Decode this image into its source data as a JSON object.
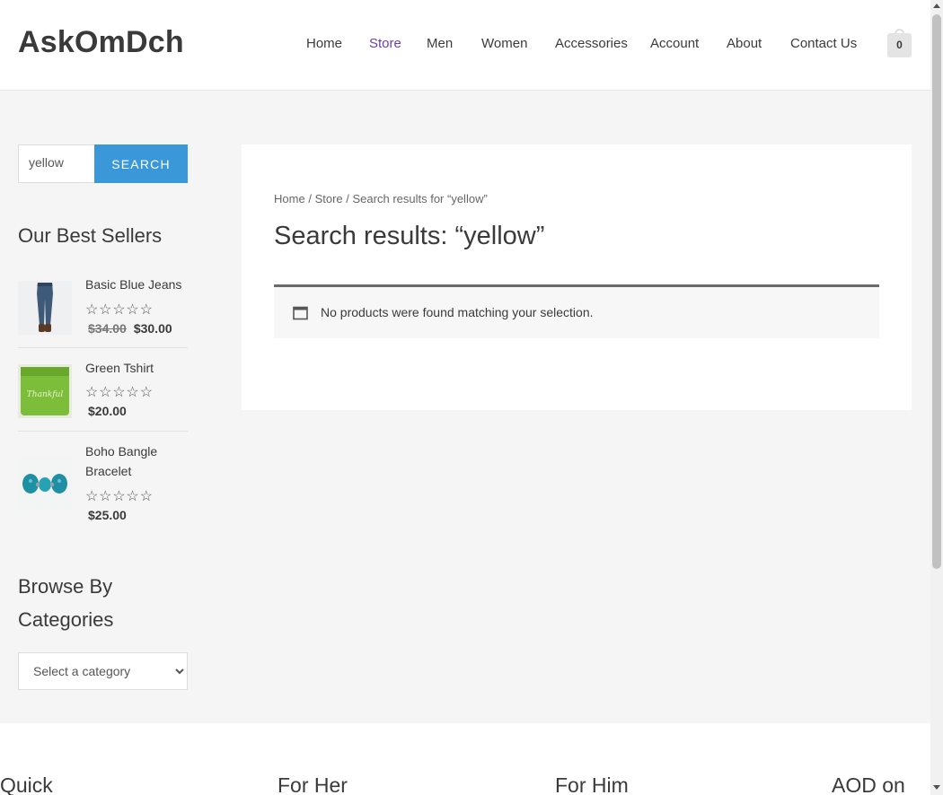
{
  "site": {
    "logo": "AskOmDch",
    "accent_color": "#6b3fa0",
    "button_color": "#3a98d8"
  },
  "nav": {
    "items": [
      {
        "label": "Home"
      },
      {
        "label": "Store",
        "active": true
      },
      {
        "label": "Men"
      },
      {
        "label": "Women"
      },
      {
        "label": "Accessories"
      },
      {
        "label": "Account"
      },
      {
        "label": "About"
      },
      {
        "label": "Contact Us"
      }
    ],
    "cart_count": "0",
    "cart_icon": "shopping-bag-icon"
  },
  "sidebar": {
    "search": {
      "value": "yellow",
      "button_label": "SEARCH"
    },
    "best_sellers": {
      "title": "Our Best Sellers",
      "products": [
        {
          "name": "Basic Blue Jeans",
          "rating": "0",
          "old_price": "$34.00",
          "price": "$30.00"
        },
        {
          "name": "Green Tshirt",
          "rating": "0",
          "price": "$20.00"
        },
        {
          "name": "Boho Bangle Bracelet",
          "rating": "0",
          "price": "$25.00"
        }
      ]
    },
    "categories": {
      "title": "Browse By Categories",
      "selected": "Select a category"
    }
  },
  "main": {
    "breadcrumb": {
      "home": "Home",
      "sep1": "/",
      "store": "Store",
      "sep2": "/",
      "current": "Search results for “yellow”"
    },
    "title": "Search results: “yellow”",
    "notice": "No products were found matching your selection.",
    "notice_icon": "calendar-icon"
  },
  "footer": {
    "columns": [
      {
        "title": "Quick"
      },
      {
        "title": "For Her"
      },
      {
        "title": "For Him"
      },
      {
        "title": "AOD on"
      }
    ]
  }
}
